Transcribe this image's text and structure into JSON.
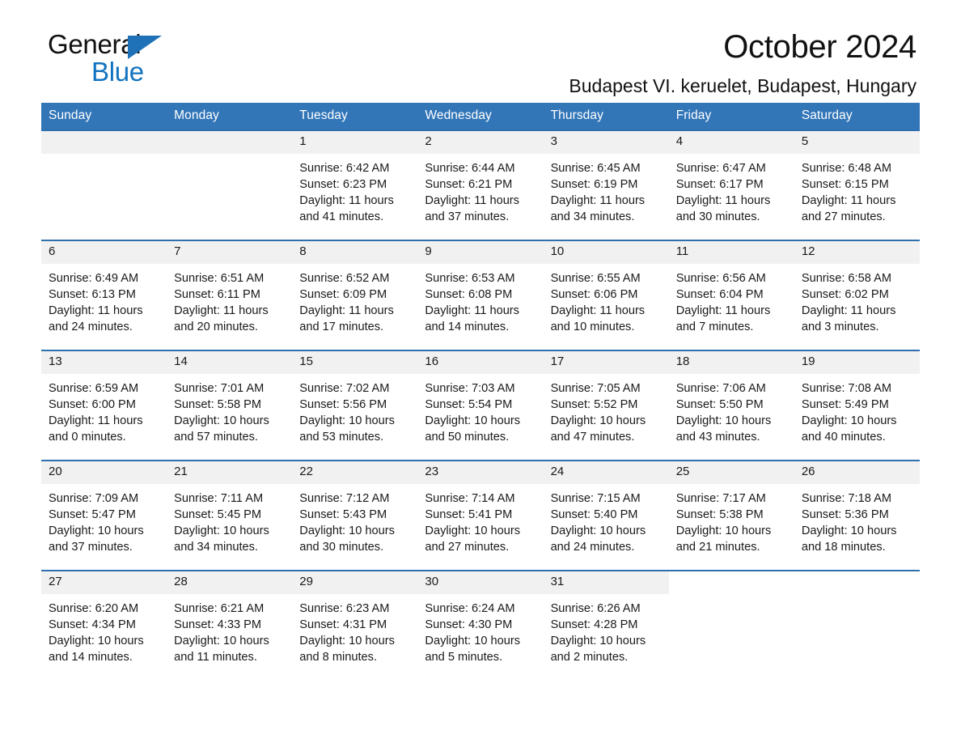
{
  "brand": {
    "name_part1": "General",
    "name_part2": "Blue",
    "triangle_color": "#1f72b8",
    "blue_text_color": "#1273bf"
  },
  "header": {
    "title": "October 2024",
    "subtitle": "Budapest VI. keruelet, Budapest, Hungary"
  },
  "theme": {
    "header_bg": "#3276b8",
    "week_rule": "#2f6fae",
    "daynum_bg": "#f1f1f1"
  },
  "weekday_headers": [
    "Sunday",
    "Monday",
    "Tuesday",
    "Wednesday",
    "Thursday",
    "Friday",
    "Saturday"
  ],
  "weeks": [
    [
      {
        "day": "",
        "sunrise": "",
        "sunset": "",
        "daylight1": "",
        "daylight2": ""
      },
      {
        "day": "",
        "sunrise": "",
        "sunset": "",
        "daylight1": "",
        "daylight2": ""
      },
      {
        "day": "1",
        "sunrise": "Sunrise: 6:42 AM",
        "sunset": "Sunset: 6:23 PM",
        "daylight1": "Daylight: 11 hours",
        "daylight2": "and 41 minutes."
      },
      {
        "day": "2",
        "sunrise": "Sunrise: 6:44 AM",
        "sunset": "Sunset: 6:21 PM",
        "daylight1": "Daylight: 11 hours",
        "daylight2": "and 37 minutes."
      },
      {
        "day": "3",
        "sunrise": "Sunrise: 6:45 AM",
        "sunset": "Sunset: 6:19 PM",
        "daylight1": "Daylight: 11 hours",
        "daylight2": "and 34 minutes."
      },
      {
        "day": "4",
        "sunrise": "Sunrise: 6:47 AM",
        "sunset": "Sunset: 6:17 PM",
        "daylight1": "Daylight: 11 hours",
        "daylight2": "and 30 minutes."
      },
      {
        "day": "5",
        "sunrise": "Sunrise: 6:48 AM",
        "sunset": "Sunset: 6:15 PM",
        "daylight1": "Daylight: 11 hours",
        "daylight2": "and 27 minutes."
      }
    ],
    [
      {
        "day": "6",
        "sunrise": "Sunrise: 6:49 AM",
        "sunset": "Sunset: 6:13 PM",
        "daylight1": "Daylight: 11 hours",
        "daylight2": "and 24 minutes."
      },
      {
        "day": "7",
        "sunrise": "Sunrise: 6:51 AM",
        "sunset": "Sunset: 6:11 PM",
        "daylight1": "Daylight: 11 hours",
        "daylight2": "and 20 minutes."
      },
      {
        "day": "8",
        "sunrise": "Sunrise: 6:52 AM",
        "sunset": "Sunset: 6:09 PM",
        "daylight1": "Daylight: 11 hours",
        "daylight2": "and 17 minutes."
      },
      {
        "day": "9",
        "sunrise": "Sunrise: 6:53 AM",
        "sunset": "Sunset: 6:08 PM",
        "daylight1": "Daylight: 11 hours",
        "daylight2": "and 14 minutes."
      },
      {
        "day": "10",
        "sunrise": "Sunrise: 6:55 AM",
        "sunset": "Sunset: 6:06 PM",
        "daylight1": "Daylight: 11 hours",
        "daylight2": "and 10 minutes."
      },
      {
        "day": "11",
        "sunrise": "Sunrise: 6:56 AM",
        "sunset": "Sunset: 6:04 PM",
        "daylight1": "Daylight: 11 hours",
        "daylight2": "and 7 minutes."
      },
      {
        "day": "12",
        "sunrise": "Sunrise: 6:58 AM",
        "sunset": "Sunset: 6:02 PM",
        "daylight1": "Daylight: 11 hours",
        "daylight2": "and 3 minutes."
      }
    ],
    [
      {
        "day": "13",
        "sunrise": "Sunrise: 6:59 AM",
        "sunset": "Sunset: 6:00 PM",
        "daylight1": "Daylight: 11 hours",
        "daylight2": "and 0 minutes."
      },
      {
        "day": "14",
        "sunrise": "Sunrise: 7:01 AM",
        "sunset": "Sunset: 5:58 PM",
        "daylight1": "Daylight: 10 hours",
        "daylight2": "and 57 minutes."
      },
      {
        "day": "15",
        "sunrise": "Sunrise: 7:02 AM",
        "sunset": "Sunset: 5:56 PM",
        "daylight1": "Daylight: 10 hours",
        "daylight2": "and 53 minutes."
      },
      {
        "day": "16",
        "sunrise": "Sunrise: 7:03 AM",
        "sunset": "Sunset: 5:54 PM",
        "daylight1": "Daylight: 10 hours",
        "daylight2": "and 50 minutes."
      },
      {
        "day": "17",
        "sunrise": "Sunrise: 7:05 AM",
        "sunset": "Sunset: 5:52 PM",
        "daylight1": "Daylight: 10 hours",
        "daylight2": "and 47 minutes."
      },
      {
        "day": "18",
        "sunrise": "Sunrise: 7:06 AM",
        "sunset": "Sunset: 5:50 PM",
        "daylight1": "Daylight: 10 hours",
        "daylight2": "and 43 minutes."
      },
      {
        "day": "19",
        "sunrise": "Sunrise: 7:08 AM",
        "sunset": "Sunset: 5:49 PM",
        "daylight1": "Daylight: 10 hours",
        "daylight2": "and 40 minutes."
      }
    ],
    [
      {
        "day": "20",
        "sunrise": "Sunrise: 7:09 AM",
        "sunset": "Sunset: 5:47 PM",
        "daylight1": "Daylight: 10 hours",
        "daylight2": "and 37 minutes."
      },
      {
        "day": "21",
        "sunrise": "Sunrise: 7:11 AM",
        "sunset": "Sunset: 5:45 PM",
        "daylight1": "Daylight: 10 hours",
        "daylight2": "and 34 minutes."
      },
      {
        "day": "22",
        "sunrise": "Sunrise: 7:12 AM",
        "sunset": "Sunset: 5:43 PM",
        "daylight1": "Daylight: 10 hours",
        "daylight2": "and 30 minutes."
      },
      {
        "day": "23",
        "sunrise": "Sunrise: 7:14 AM",
        "sunset": "Sunset: 5:41 PM",
        "daylight1": "Daylight: 10 hours",
        "daylight2": "and 27 minutes."
      },
      {
        "day": "24",
        "sunrise": "Sunrise: 7:15 AM",
        "sunset": "Sunset: 5:40 PM",
        "daylight1": "Daylight: 10 hours",
        "daylight2": "and 24 minutes."
      },
      {
        "day": "25",
        "sunrise": "Sunrise: 7:17 AM",
        "sunset": "Sunset: 5:38 PM",
        "daylight1": "Daylight: 10 hours",
        "daylight2": "and 21 minutes."
      },
      {
        "day": "26",
        "sunrise": "Sunrise: 7:18 AM",
        "sunset": "Sunset: 5:36 PM",
        "daylight1": "Daylight: 10 hours",
        "daylight2": "and 18 minutes."
      }
    ],
    [
      {
        "day": "27",
        "sunrise": "Sunrise: 6:20 AM",
        "sunset": "Sunset: 4:34 PM",
        "daylight1": "Daylight: 10 hours",
        "daylight2": "and 14 minutes."
      },
      {
        "day": "28",
        "sunrise": "Sunrise: 6:21 AM",
        "sunset": "Sunset: 4:33 PM",
        "daylight1": "Daylight: 10 hours",
        "daylight2": "and 11 minutes."
      },
      {
        "day": "29",
        "sunrise": "Sunrise: 6:23 AM",
        "sunset": "Sunset: 4:31 PM",
        "daylight1": "Daylight: 10 hours",
        "daylight2": "and 8 minutes."
      },
      {
        "day": "30",
        "sunrise": "Sunrise: 6:24 AM",
        "sunset": "Sunset: 4:30 PM",
        "daylight1": "Daylight: 10 hours",
        "daylight2": "and 5 minutes."
      },
      {
        "day": "31",
        "sunrise": "Sunrise: 6:26 AM",
        "sunset": "Sunset: 4:28 PM",
        "daylight1": "Daylight: 10 hours",
        "daylight2": "and 2 minutes."
      },
      {
        "day": "",
        "sunrise": "",
        "sunset": "",
        "daylight1": "",
        "daylight2": ""
      },
      {
        "day": "",
        "sunrise": "",
        "sunset": "",
        "daylight1": "",
        "daylight2": ""
      }
    ]
  ]
}
